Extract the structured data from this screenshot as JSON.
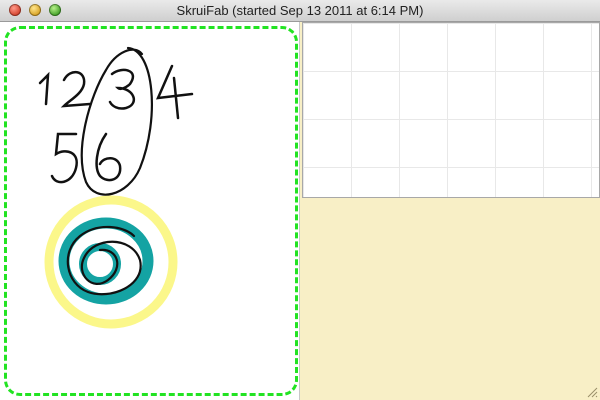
{
  "window": {
    "title": "SkruiFab (started Sep 13 2011 at 6:14 PM)",
    "buttons": [
      "close",
      "minimize",
      "zoom"
    ]
  },
  "canvas": {
    "handwritten_text": [
      "1",
      "2",
      "3",
      "4",
      "5",
      "6"
    ],
    "selection_color": "#22e322",
    "ink_color": "#111111",
    "highlight_yellow": "#fbf78a",
    "highlight_teal": "#14a3a3"
  },
  "colors": {
    "sketch_background": "#ffffff",
    "empty_area": "#f8efc6",
    "grid_line": "#e8e8e8"
  }
}
